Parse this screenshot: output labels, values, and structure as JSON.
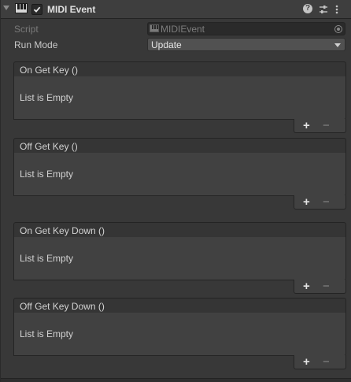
{
  "component": {
    "title": "MIDI Event",
    "enabled": true,
    "icons": [
      "foldout-arrow-icon",
      "piano-icon",
      "help-icon",
      "presets-icon",
      "context-menu-icon"
    ]
  },
  "properties": {
    "script_label": "Script",
    "script_value": "MIDIEvent",
    "run_mode_label": "Run Mode",
    "run_mode_value": "Update"
  },
  "events": [
    {
      "title": "On Get Key ()",
      "empty_text": "List is Empty",
      "add_label": "+",
      "remove_label": "−"
    },
    {
      "title": "Off Get Key ()",
      "empty_text": "List is Empty",
      "add_label": "+",
      "remove_label": "−"
    },
    {
      "title": "On Get Key Down ()",
      "empty_text": "List is Empty",
      "add_label": "+",
      "remove_label": "−"
    },
    {
      "title": "Off Get Key Down ()",
      "empty_text": "List is Empty",
      "add_label": "+",
      "remove_label": "−"
    }
  ],
  "colors": {
    "background": "#383838",
    "header": "#3e3e3e",
    "list_body": "#414141",
    "text": "#c8c8c8"
  }
}
